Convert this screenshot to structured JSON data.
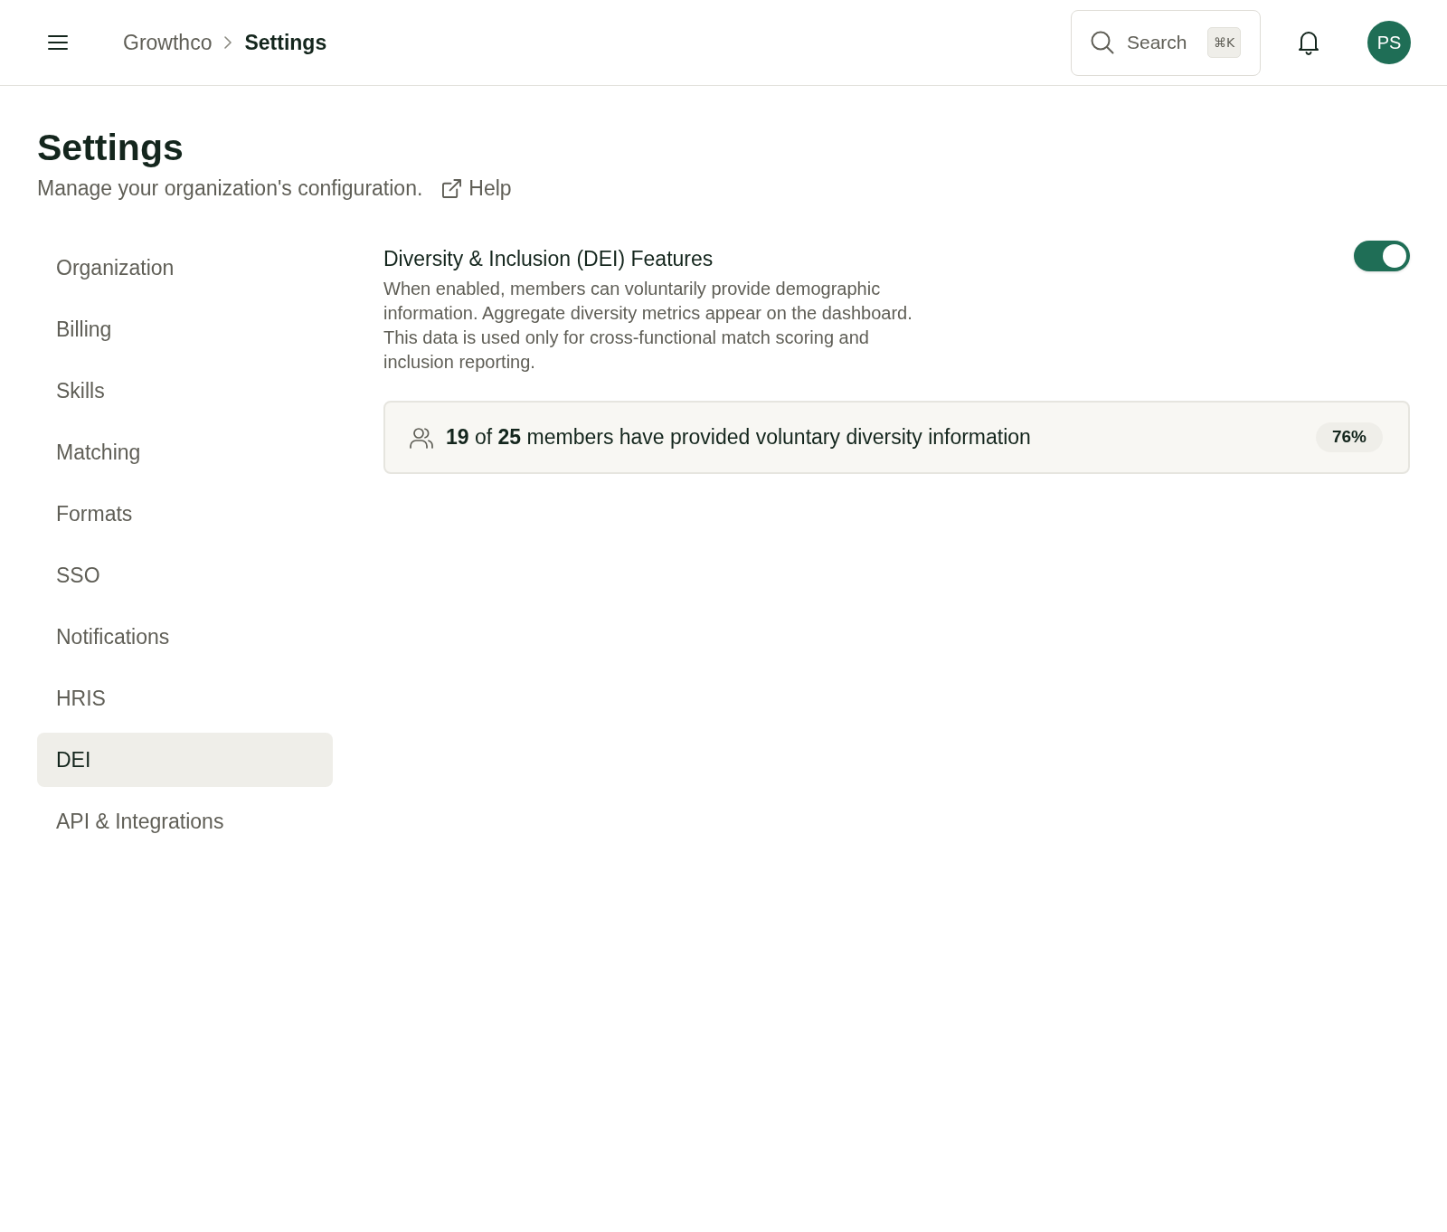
{
  "topbar": {
    "breadcrumb": [
      {
        "label": "Growthco",
        "current": false
      },
      {
        "label": "Settings",
        "current": true
      }
    ],
    "search": {
      "label": "Search",
      "shortcut": "⌘K"
    },
    "avatar": {
      "initials": "PS"
    }
  },
  "header": {
    "title": "Settings",
    "subtitle": "Manage your organization's configuration.",
    "help_link": "Help"
  },
  "sidebar": {
    "items": [
      {
        "label": "Organization",
        "selected": false
      },
      {
        "label": "Billing",
        "selected": false
      },
      {
        "label": "Skills",
        "selected": false
      },
      {
        "label": "Matching",
        "selected": false
      },
      {
        "label": "Formats",
        "selected": false
      },
      {
        "label": "SSO",
        "selected": false
      },
      {
        "label": "Notifications",
        "selected": false
      },
      {
        "label": "HRIS",
        "selected": false
      },
      {
        "label": "DEI",
        "selected": true
      },
      {
        "label": "API & Integrations",
        "selected": false
      }
    ]
  },
  "dei_section": {
    "title": "Diversity & Inclusion (DEI) Features",
    "description": "When enabled, members can voluntarily provide demographic information. Aggregate diversity metrics appear on the dashboard. This data is used only for cross-functional match scoring and inclusion reporting.",
    "enabled": true,
    "stats": {
      "text": "**19** of **25** members have provided voluntary diversity information",
      "percent": "76%"
    }
  }
}
